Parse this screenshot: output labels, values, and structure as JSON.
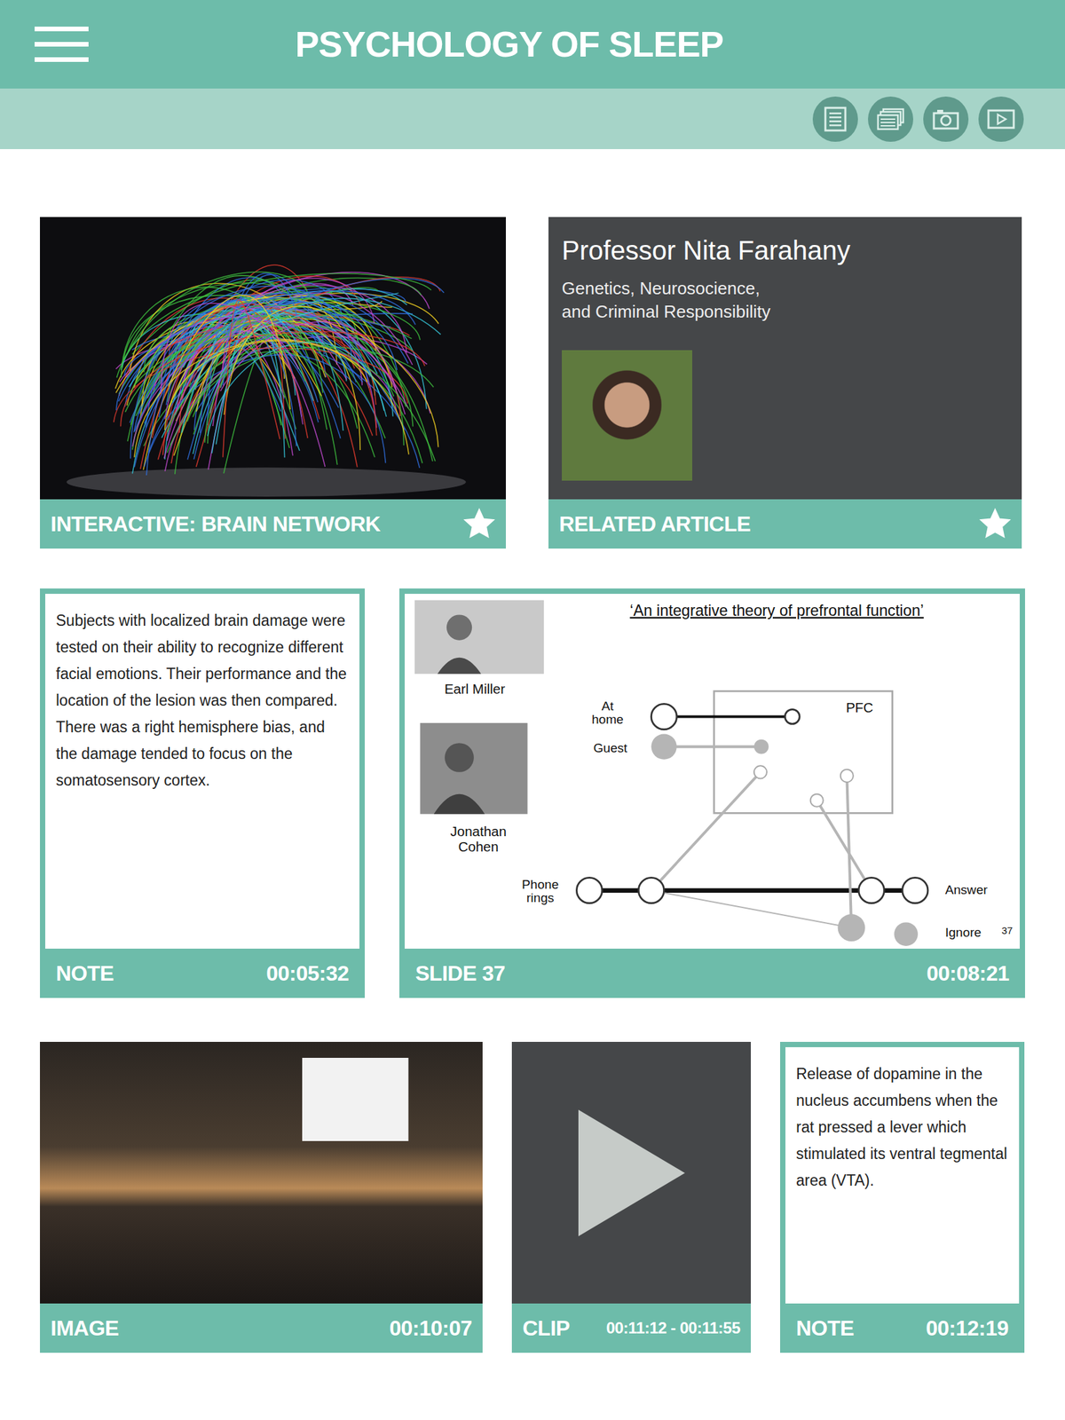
{
  "header": {
    "title": "PSYCHOLOGY OF SLEEP"
  },
  "cards": [
    {
      "kind": "interactive",
      "label": "INTERACTIVE: BRAIN NETWORK",
      "favorite": true
    },
    {
      "kind": "article",
      "label": "RELATED ARTICLE",
      "favorite": true,
      "title": "Professor Nita Farahany",
      "subtitle_lines": [
        "Genetics, Neurosocience,",
        "and Criminal Responsibility"
      ]
    },
    {
      "kind": "note",
      "label": "NOTE",
      "time": "00:05:32",
      "paragraphs": [
        "Subjects with localized brain damage were tested on their ability to recognize different facial emotions. Their performance and the location of the lesion was then compared.",
        "There was a right hemisphere bias, and the damage tended to focus on the somatosensory cortex."
      ]
    },
    {
      "kind": "slide",
      "label": "SLIDE 37",
      "time": "00:08:21",
      "slide": {
        "title": "‘An integrative theory of prefrontal function’",
        "number": "37",
        "people": [
          {
            "lines": [
              "Earl Miller"
            ]
          },
          {
            "lines": [
              "Jonathan",
              "Cohen"
            ]
          }
        ],
        "box_label": "PFC",
        "inputs": [
          {
            "lines": [
              "At",
              "home"
            ]
          },
          {
            "lines": [
              "Guest"
            ]
          }
        ],
        "stimulus": {
          "lines": [
            "Phone",
            "rings"
          ]
        },
        "responses": [
          {
            "lines": [
              "Answer"
            ]
          },
          {
            "lines": [
              "Ignore"
            ]
          }
        ]
      }
    },
    {
      "kind": "image",
      "label": "IMAGE",
      "time": "00:10:07"
    },
    {
      "kind": "clip",
      "label": "CLIP",
      "time": "00:11:12 - 00:11:55"
    },
    {
      "kind": "note",
      "label": "NOTE",
      "time": "00:12:19",
      "paragraphs": [
        "Release of dopamine in the nucleus accumbens when the rat pressed a lever which stimulated its ventral tegmental area (VTA)."
      ]
    }
  ]
}
